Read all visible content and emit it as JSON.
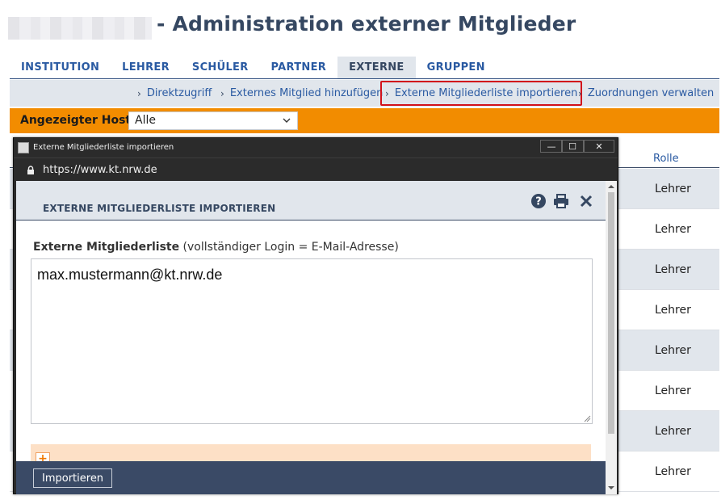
{
  "page": {
    "title": "- Administration externer Mitglieder"
  },
  "tabs": [
    {
      "label": "INSTITUTION",
      "active": false
    },
    {
      "label": "LEHRER",
      "active": false
    },
    {
      "label": "SCHÜLER",
      "active": false
    },
    {
      "label": "PARTNER",
      "active": false
    },
    {
      "label": "EXTERNE",
      "active": true
    },
    {
      "label": "GRUPPEN",
      "active": false
    }
  ],
  "subnav": [
    {
      "label": "Direktzugriff"
    },
    {
      "label": "Externes Mitglied hinzufügen"
    },
    {
      "label": "Externe Mitgliederliste importieren",
      "highlighted": true
    },
    {
      "label": "Zuordnungen verwalten"
    }
  ],
  "host": {
    "label": "Angezeigter Host",
    "selected": "Alle"
  },
  "table": {
    "column_rolle": "Rolle",
    "rows": [
      {
        "rolle": "Lehrer"
      },
      {
        "rolle": "Lehrer"
      },
      {
        "rolle": "Lehrer"
      },
      {
        "rolle": "Lehrer"
      },
      {
        "rolle": "Lehrer"
      },
      {
        "rolle": "Lehrer"
      },
      {
        "rolle": "Lehrer"
      },
      {
        "rolle": "Lehrer"
      }
    ]
  },
  "popup": {
    "window_title": "Externe Mitgliederliste importieren",
    "url": "https://www.kt.nrw.de",
    "heading": "EXTERNE MITGLIEDERLISTE IMPORTIEREN",
    "field_label_bold": "Externe Mitgliederliste",
    "field_label_hint": " (vollständiger Login = E-Mail-Adresse)",
    "textarea_value": "max.mustermann@kt.nrw.de",
    "import_button": "Importieren"
  },
  "colors": {
    "nav_blue": "#2a5aa2",
    "title_navy": "#354761",
    "orange_bar": "#f28c00",
    "highlight_red": "#d2121b",
    "footer_navy": "#3a4a66"
  }
}
